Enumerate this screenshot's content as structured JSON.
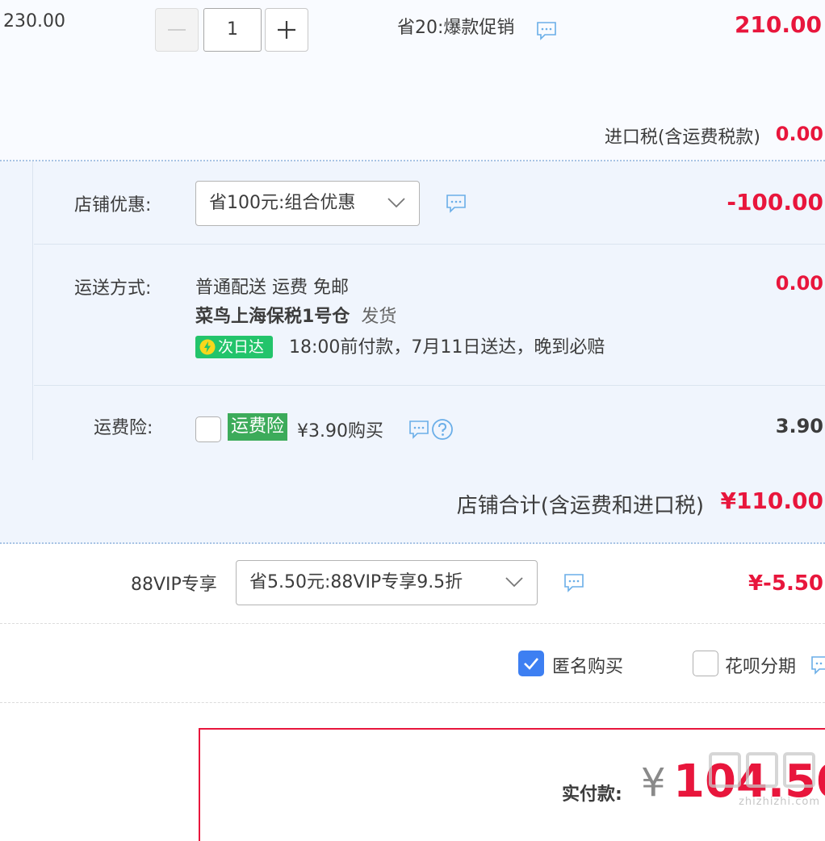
{
  "item": {
    "original_price": "230.00",
    "quantity": "1",
    "promo": "省20:爆款促销",
    "subtotal": "210.00",
    "tax_label": "进口税(含运费税款)",
    "tax_value": "0.00"
  },
  "shop": {
    "discount_label": "店铺优惠:",
    "discount_select": "省100元:组合优惠",
    "discount_value": "-100.00",
    "shipping_label": "运送方式:",
    "shipping_method": "普通配送 运费 免邮",
    "shipping_value": "0.00",
    "warehouse_name": "菜鸟上海保税1号仓",
    "warehouse_suffix": "发货",
    "nextday_badge": "次日达",
    "delivery_note": "18:00前付款，7月11日送达，晚到必赔",
    "insurance_label": "运费险:",
    "insurance_tag": "运费险",
    "insurance_price": "¥3.90购买",
    "insurance_value": "3.90",
    "total_label": "店铺合计(含运费和进口税)",
    "total_value": "¥110.00"
  },
  "vip": {
    "label": "88VIP专享",
    "select": "省5.50元:88VIP专享9.5折",
    "value": "¥-5.50"
  },
  "options": {
    "anonymous_label": "匿名购买",
    "anonymous_checked": true,
    "huabei_label": "花呗分期"
  },
  "payment": {
    "label": "实付款:",
    "currency": "¥",
    "amount": "104.50"
  },
  "watermark": "zhizhizhi.com",
  "colors": {
    "accent_red": "#e8163c",
    "link_blue": "#3d7ff2",
    "badge_green": "#23c46b",
    "tag_green": "#3cab5a"
  }
}
